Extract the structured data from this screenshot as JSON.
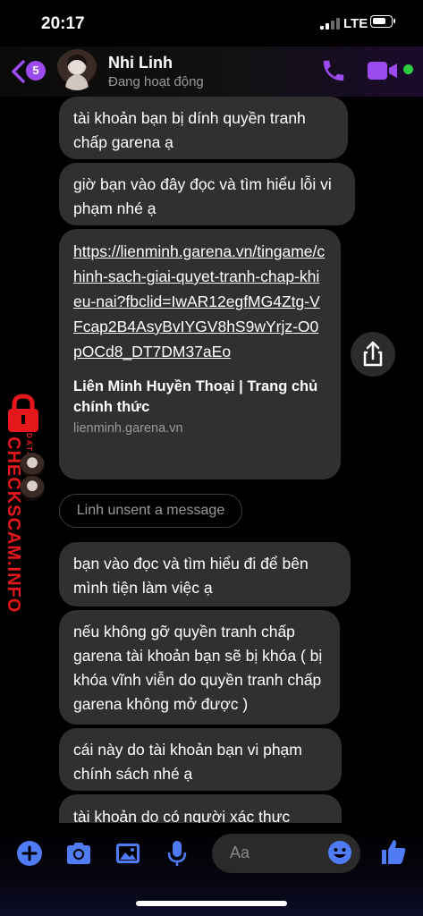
{
  "status_bar": {
    "time": "20:17",
    "network": "LTE"
  },
  "header": {
    "unread_count": "5",
    "contact_name": "Nhi Linh",
    "contact_status": "Đang hoạt động",
    "accent_color": "#9b4bf0",
    "online_color": "#2ecc40"
  },
  "messages": [
    {
      "text": "tài khoản bạn bị dính quyền tranh chấp garena ạ"
    },
    {
      "text": "giờ bạn vào đây đọc và tìm hiểu lỗi vi phạm nhé ạ"
    }
  ],
  "link_preview": {
    "url": "https://lienminh.garena.vn/tingame/chinh-sach-giai-quyet-tranh-chap-khieu-nai?fbclid=IwAR12egfMG4Ztg-VFcap2B4AsyBvIYGV8hS9wYrjz-O0pOCd8_DT7DM37aEo",
    "title": "Liên Minh Huyền Thoại | Trang chủ chính thức",
    "domain": "lienminh.garena.vn"
  },
  "unsent_notice": "Linh unsent a message",
  "messages_after": [
    {
      "text": "bạn vào đọc và tìm hiểu đi để bên mình tiện làm việc ạ"
    },
    {
      "text": "nếu không gỡ quyền tranh chấp garena tài khoản bạn sẽ bị khóa ( bị khóa vĩnh viễn do quyền tranh chấp garena không mở được )"
    },
    {
      "text": "cái này do tài khoản bạn vi phạm chính sách nhé ạ"
    },
    {
      "text": "tài khoản do có người xác thực"
    }
  ],
  "watermark": {
    "brand": "CHECKSCAM.INFO",
    "sub": "DATA CENTER",
    "color": "#e5171a"
  },
  "composer": {
    "placeholder": "Aa",
    "icons": [
      "plus-icon",
      "camera-icon",
      "image-icon",
      "microphone-icon",
      "emoji-icon",
      "thumbs-up-icon"
    ],
    "icon_color": "#4f7cf5"
  }
}
